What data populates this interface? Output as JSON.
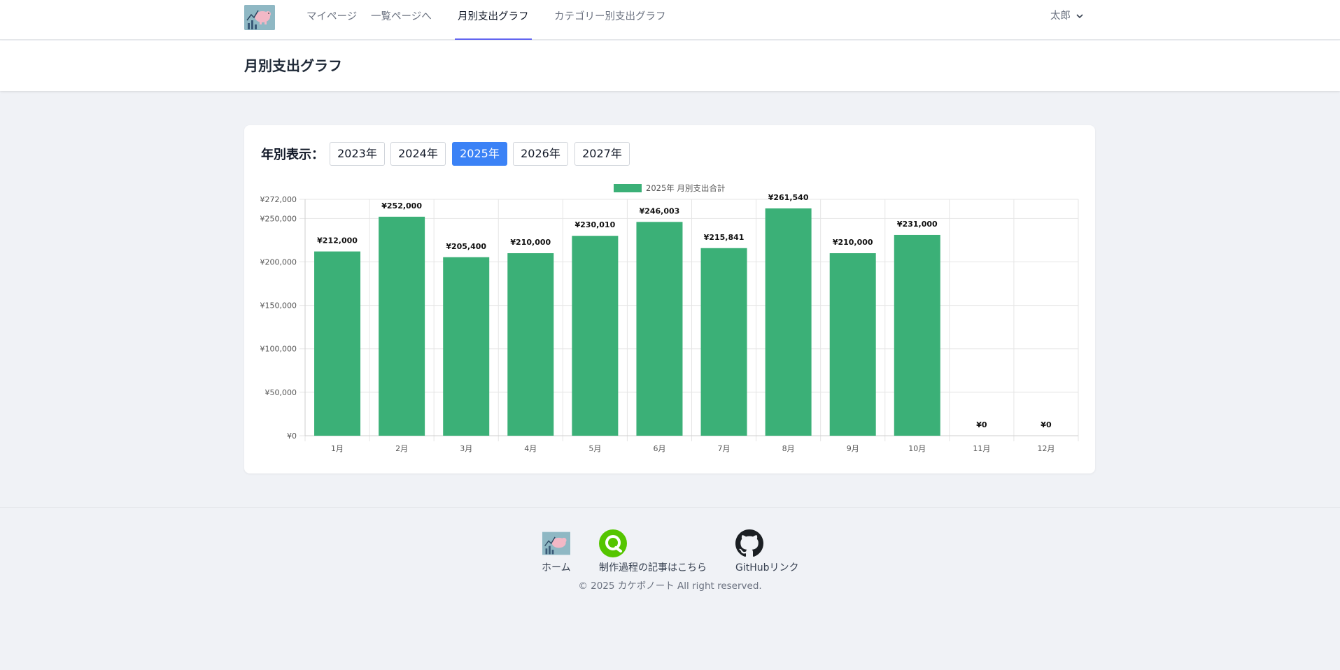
{
  "nav": {
    "items": [
      {
        "label": "マイページ"
      },
      {
        "label": "一覧ページへ"
      },
      {
        "label": "月別支出グラフ"
      },
      {
        "label": "カテゴリー別支出グラフ"
      }
    ],
    "active": "月別支出グラフ",
    "user": "太郎"
  },
  "page": {
    "title": "月別支出グラフ"
  },
  "year_filter": {
    "label": "年別表示：",
    "years": [
      "2023年",
      "2024年",
      "2025年",
      "2026年",
      "2027年"
    ],
    "selected": "2025年"
  },
  "chart_data": {
    "type": "bar",
    "legend": "2025年 月別支出合計",
    "legend_position": "top",
    "color": "#3bb077",
    "categories": [
      "1月",
      "2月",
      "3月",
      "4月",
      "5月",
      "6月",
      "7月",
      "8月",
      "9月",
      "10月",
      "11月",
      "12月"
    ],
    "values": [
      212000,
      252000,
      205400,
      210000,
      230010,
      246003,
      215841,
      261540,
      210000,
      231000,
      0,
      0
    ],
    "data_labels": [
      "¥212,000",
      "¥252,000",
      "¥205,400",
      "¥210,000",
      "¥230,010",
      "¥246,003",
      "¥215,841",
      "¥261,540",
      "¥210,000",
      "¥231,000",
      "¥0",
      "¥0"
    ],
    "yticks": [
      0,
      50000,
      100000,
      150000,
      200000,
      250000,
      272000
    ],
    "ytick_labels": [
      "¥0",
      "¥50,000",
      "¥100,000",
      "¥150,000",
      "¥200,000",
      "¥250,000",
      "¥272,000"
    ],
    "ylim": [
      0,
      272000
    ],
    "grid": true
  },
  "footer": {
    "home": "ホーム",
    "article": "制作過程の記事はこちら",
    "github": "GitHubリンク",
    "copyright": "© 2025 カケボノート All right reserved."
  }
}
